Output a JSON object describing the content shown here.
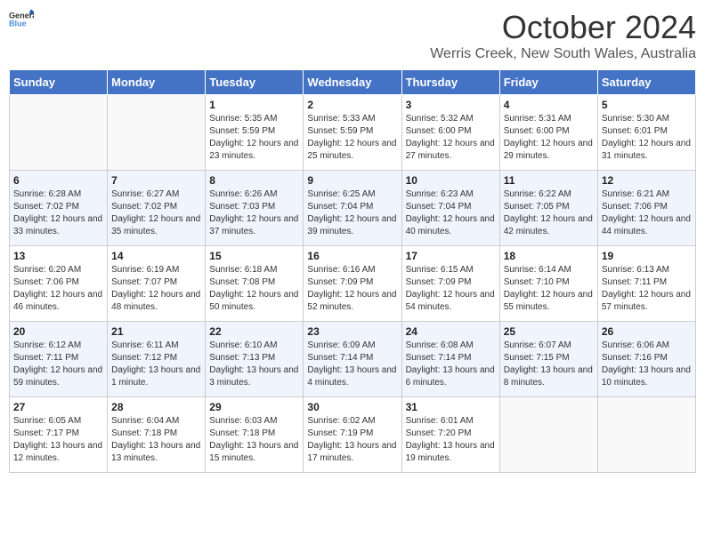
{
  "logo": {
    "line1": "General",
    "line2": "Blue"
  },
  "title": "October 2024",
  "subtitle": "Werris Creek, New South Wales, Australia",
  "days_of_week": [
    "Sunday",
    "Monday",
    "Tuesday",
    "Wednesday",
    "Thursday",
    "Friday",
    "Saturday"
  ],
  "weeks": [
    [
      {
        "day": "",
        "info": ""
      },
      {
        "day": "",
        "info": ""
      },
      {
        "day": "1",
        "info": "Sunrise: 5:35 AM\nSunset: 5:59 PM\nDaylight: 12 hours and 23 minutes."
      },
      {
        "day": "2",
        "info": "Sunrise: 5:33 AM\nSunset: 5:59 PM\nDaylight: 12 hours and 25 minutes."
      },
      {
        "day": "3",
        "info": "Sunrise: 5:32 AM\nSunset: 6:00 PM\nDaylight: 12 hours and 27 minutes."
      },
      {
        "day": "4",
        "info": "Sunrise: 5:31 AM\nSunset: 6:00 PM\nDaylight: 12 hours and 29 minutes."
      },
      {
        "day": "5",
        "info": "Sunrise: 5:30 AM\nSunset: 6:01 PM\nDaylight: 12 hours and 31 minutes."
      }
    ],
    [
      {
        "day": "6",
        "info": "Sunrise: 6:28 AM\nSunset: 7:02 PM\nDaylight: 12 hours and 33 minutes."
      },
      {
        "day": "7",
        "info": "Sunrise: 6:27 AM\nSunset: 7:02 PM\nDaylight: 12 hours and 35 minutes."
      },
      {
        "day": "8",
        "info": "Sunrise: 6:26 AM\nSunset: 7:03 PM\nDaylight: 12 hours and 37 minutes."
      },
      {
        "day": "9",
        "info": "Sunrise: 6:25 AM\nSunset: 7:04 PM\nDaylight: 12 hours and 39 minutes."
      },
      {
        "day": "10",
        "info": "Sunrise: 6:23 AM\nSunset: 7:04 PM\nDaylight: 12 hours and 40 minutes."
      },
      {
        "day": "11",
        "info": "Sunrise: 6:22 AM\nSunset: 7:05 PM\nDaylight: 12 hours and 42 minutes."
      },
      {
        "day": "12",
        "info": "Sunrise: 6:21 AM\nSunset: 7:06 PM\nDaylight: 12 hours and 44 minutes."
      }
    ],
    [
      {
        "day": "13",
        "info": "Sunrise: 6:20 AM\nSunset: 7:06 PM\nDaylight: 12 hours and 46 minutes."
      },
      {
        "day": "14",
        "info": "Sunrise: 6:19 AM\nSunset: 7:07 PM\nDaylight: 12 hours and 48 minutes."
      },
      {
        "day": "15",
        "info": "Sunrise: 6:18 AM\nSunset: 7:08 PM\nDaylight: 12 hours and 50 minutes."
      },
      {
        "day": "16",
        "info": "Sunrise: 6:16 AM\nSunset: 7:09 PM\nDaylight: 12 hours and 52 minutes."
      },
      {
        "day": "17",
        "info": "Sunrise: 6:15 AM\nSunset: 7:09 PM\nDaylight: 12 hours and 54 minutes."
      },
      {
        "day": "18",
        "info": "Sunrise: 6:14 AM\nSunset: 7:10 PM\nDaylight: 12 hours and 55 minutes."
      },
      {
        "day": "19",
        "info": "Sunrise: 6:13 AM\nSunset: 7:11 PM\nDaylight: 12 hours and 57 minutes."
      }
    ],
    [
      {
        "day": "20",
        "info": "Sunrise: 6:12 AM\nSunset: 7:11 PM\nDaylight: 12 hours and 59 minutes."
      },
      {
        "day": "21",
        "info": "Sunrise: 6:11 AM\nSunset: 7:12 PM\nDaylight: 13 hours and 1 minute."
      },
      {
        "day": "22",
        "info": "Sunrise: 6:10 AM\nSunset: 7:13 PM\nDaylight: 13 hours and 3 minutes."
      },
      {
        "day": "23",
        "info": "Sunrise: 6:09 AM\nSunset: 7:14 PM\nDaylight: 13 hours and 4 minutes."
      },
      {
        "day": "24",
        "info": "Sunrise: 6:08 AM\nSunset: 7:14 PM\nDaylight: 13 hours and 6 minutes."
      },
      {
        "day": "25",
        "info": "Sunrise: 6:07 AM\nSunset: 7:15 PM\nDaylight: 13 hours and 8 minutes."
      },
      {
        "day": "26",
        "info": "Sunrise: 6:06 AM\nSunset: 7:16 PM\nDaylight: 13 hours and 10 minutes."
      }
    ],
    [
      {
        "day": "27",
        "info": "Sunrise: 6:05 AM\nSunset: 7:17 PM\nDaylight: 13 hours and 12 minutes."
      },
      {
        "day": "28",
        "info": "Sunrise: 6:04 AM\nSunset: 7:18 PM\nDaylight: 13 hours and 13 minutes."
      },
      {
        "day": "29",
        "info": "Sunrise: 6:03 AM\nSunset: 7:18 PM\nDaylight: 13 hours and 15 minutes."
      },
      {
        "day": "30",
        "info": "Sunrise: 6:02 AM\nSunset: 7:19 PM\nDaylight: 13 hours and 17 minutes."
      },
      {
        "day": "31",
        "info": "Sunrise: 6:01 AM\nSunset: 7:20 PM\nDaylight: 13 hours and 19 minutes."
      },
      {
        "day": "",
        "info": ""
      },
      {
        "day": "",
        "info": ""
      }
    ]
  ]
}
